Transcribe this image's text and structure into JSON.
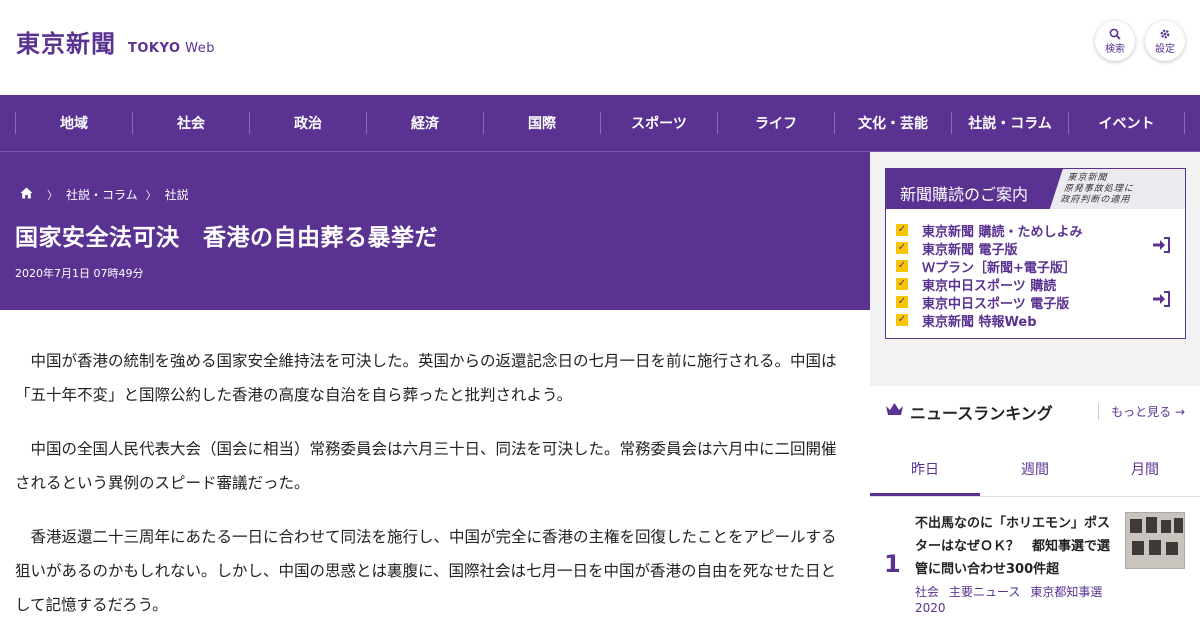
{
  "header": {
    "logo_main": "東京新聞",
    "logo_tokyo": "TOKYO",
    "logo_web": "Web",
    "search_label": "検索",
    "settings_label": "設定"
  },
  "nav": {
    "items": [
      "地域",
      "社会",
      "政治",
      "経済",
      "国際",
      "スポーツ",
      "ライフ",
      "文化・芸能",
      "社説・コラム",
      "イベント"
    ]
  },
  "article": {
    "breadcrumb": [
      "社説・コラム",
      "社説"
    ],
    "title": "国家安全法可決　香港の自由葬る暴挙だ",
    "date": "2020年7月1日 07時49分",
    "paragraphs": [
      "中国が香港の統制を強める国家安全維持法を可決した。英国からの返還記念日の七月一日を前に施行される。中国は「五十年不変」と国際公約した香港の高度な自治を自ら葬ったと批判されよう。",
      "中国の全国人民代表大会（国会に相当）常務委員会は六月三十日、同法を可決した。常務委員会は六月中に二回開催されるという異例のスピード審議だった。",
      "香港返還二十三周年にあたる一日に合わせて同法を施行し、中国が完全に香港の主権を回復したことをアピールする狙いがあるのかもしれない。しかし、中国の思惑とは裏腹に、国際社会は七月一日を中国が香港の自由を死なせた日として記憶するだろう。"
    ]
  },
  "subscription": {
    "heading": "新聞購読のご案内",
    "items": [
      "東京新聞 購読・ためしよみ",
      "東京新聞 電子版",
      "Ｗプラン［新聞+電子版］",
      "東京中日スポーツ 購読",
      "東京中日スポーツ 電子版",
      "東京新聞 特報Web"
    ]
  },
  "ranking": {
    "title": "ニュースランキング",
    "more": "もっと見る",
    "tabs": [
      "昨日",
      "週間",
      "月間"
    ],
    "top": {
      "rank": "1",
      "headline": "不出馬なのに「ホリエモン」ポスターはなぜＯＫ？　都知事選で選管に問い合わせ300件超",
      "tags": [
        "社会",
        "主要ニュース",
        "東京都知事選2020"
      ]
    }
  },
  "colors": {
    "brand": "#5a3291",
    "accent": "#f7c600"
  },
  "icons": {
    "search": "search-icon",
    "settings": "gear-icon",
    "home": "home-icon",
    "crown": "crown-icon",
    "login": "sign-in-icon"
  }
}
